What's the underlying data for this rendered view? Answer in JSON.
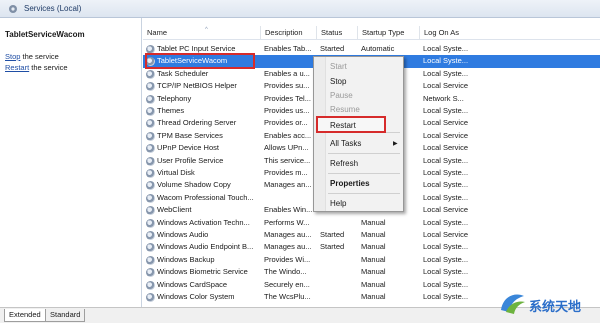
{
  "window": {
    "title": "Services (Local)"
  },
  "left_pane": {
    "service_name": "TabletServiceWacom",
    "stop_link": "Stop",
    "stop_suffix": " the service",
    "restart_link": "Restart",
    "restart_suffix": " the service"
  },
  "columns": [
    "Name",
    "Description",
    "Status",
    "Startup Type",
    "Log On As"
  ],
  "rows": [
    [
      "Tablet PC Input Service",
      "Enables Tab...",
      "Started",
      "Automatic",
      "Local Syste..."
    ],
    [
      "TabletServiceWacom",
      "",
      "",
      "",
      "Local Syste..."
    ],
    [
      "Task Scheduler",
      "Enables a u...",
      "",
      "",
      "Local Syste..."
    ],
    [
      "TCP/IP NetBIOS Helper",
      "Provides su...",
      "",
      "",
      "Local Service"
    ],
    [
      "Telephony",
      "Provides Tel...",
      "",
      "",
      "Network S..."
    ],
    [
      "Themes",
      "Provides us...",
      "",
      "",
      "Local Syste..."
    ],
    [
      "Thread Ordering Server",
      "Provides or...",
      "",
      "",
      "Local Service"
    ],
    [
      "TPM Base Services",
      "Enables acc...",
      "",
      "",
      "Local Service"
    ],
    [
      "UPnP Device Host",
      "Allows UPn...",
      "",
      "",
      "Local Service"
    ],
    [
      "User Profile Service",
      "This service...",
      "",
      "",
      "Local Syste..."
    ],
    [
      "Virtual Disk",
      "Provides m...",
      "",
      "",
      "Local Syste..."
    ],
    [
      "Volume Shadow Copy",
      "Manages an...",
      "",
      "",
      "Local Syste..."
    ],
    [
      "Wacom Professional Touch...",
      "",
      "",
      "",
      "Local Syste..."
    ],
    [
      "WebClient",
      "Enables Win...",
      "",
      "",
      "Local Service"
    ],
    [
      "Windows Activation Techn...",
      "Performs W...",
      "",
      "Manual",
      "Local Syste..."
    ],
    [
      "Windows Audio",
      "Manages au...",
      "Started",
      "Manual",
      "Local Service"
    ],
    [
      "Windows Audio Endpoint B...",
      "Manages au...",
      "Started",
      "Manual",
      "Local Syste..."
    ],
    [
      "Windows Backup",
      "Provides Wi...",
      "",
      "Manual",
      "Local Syste..."
    ],
    [
      "Windows Biometric Service",
      "The Windo...",
      "",
      "Manual",
      "Local Syste..."
    ],
    [
      "Windows CardSpace",
      "Securely en...",
      "",
      "Manual",
      "Local Syste..."
    ],
    [
      "Windows Color System",
      "The WcsPlu...",
      "",
      "Manual",
      "Local Syste..."
    ]
  ],
  "selected_row_index": 1,
  "context_menu": {
    "start": "Start",
    "stop": "Stop",
    "pause": "Pause",
    "resume": "Resume",
    "restart": "Restart",
    "all_tasks": "All Tasks",
    "refresh": "Refresh",
    "properties": "Properties",
    "help": "Help"
  },
  "bottom_tabs": {
    "extended": "Extended",
    "standard": "Standard"
  },
  "watermark": {
    "text": "系统天地"
  },
  "colors": {
    "selection": "#2f7be0",
    "highlight_box": "#d62b2b"
  }
}
